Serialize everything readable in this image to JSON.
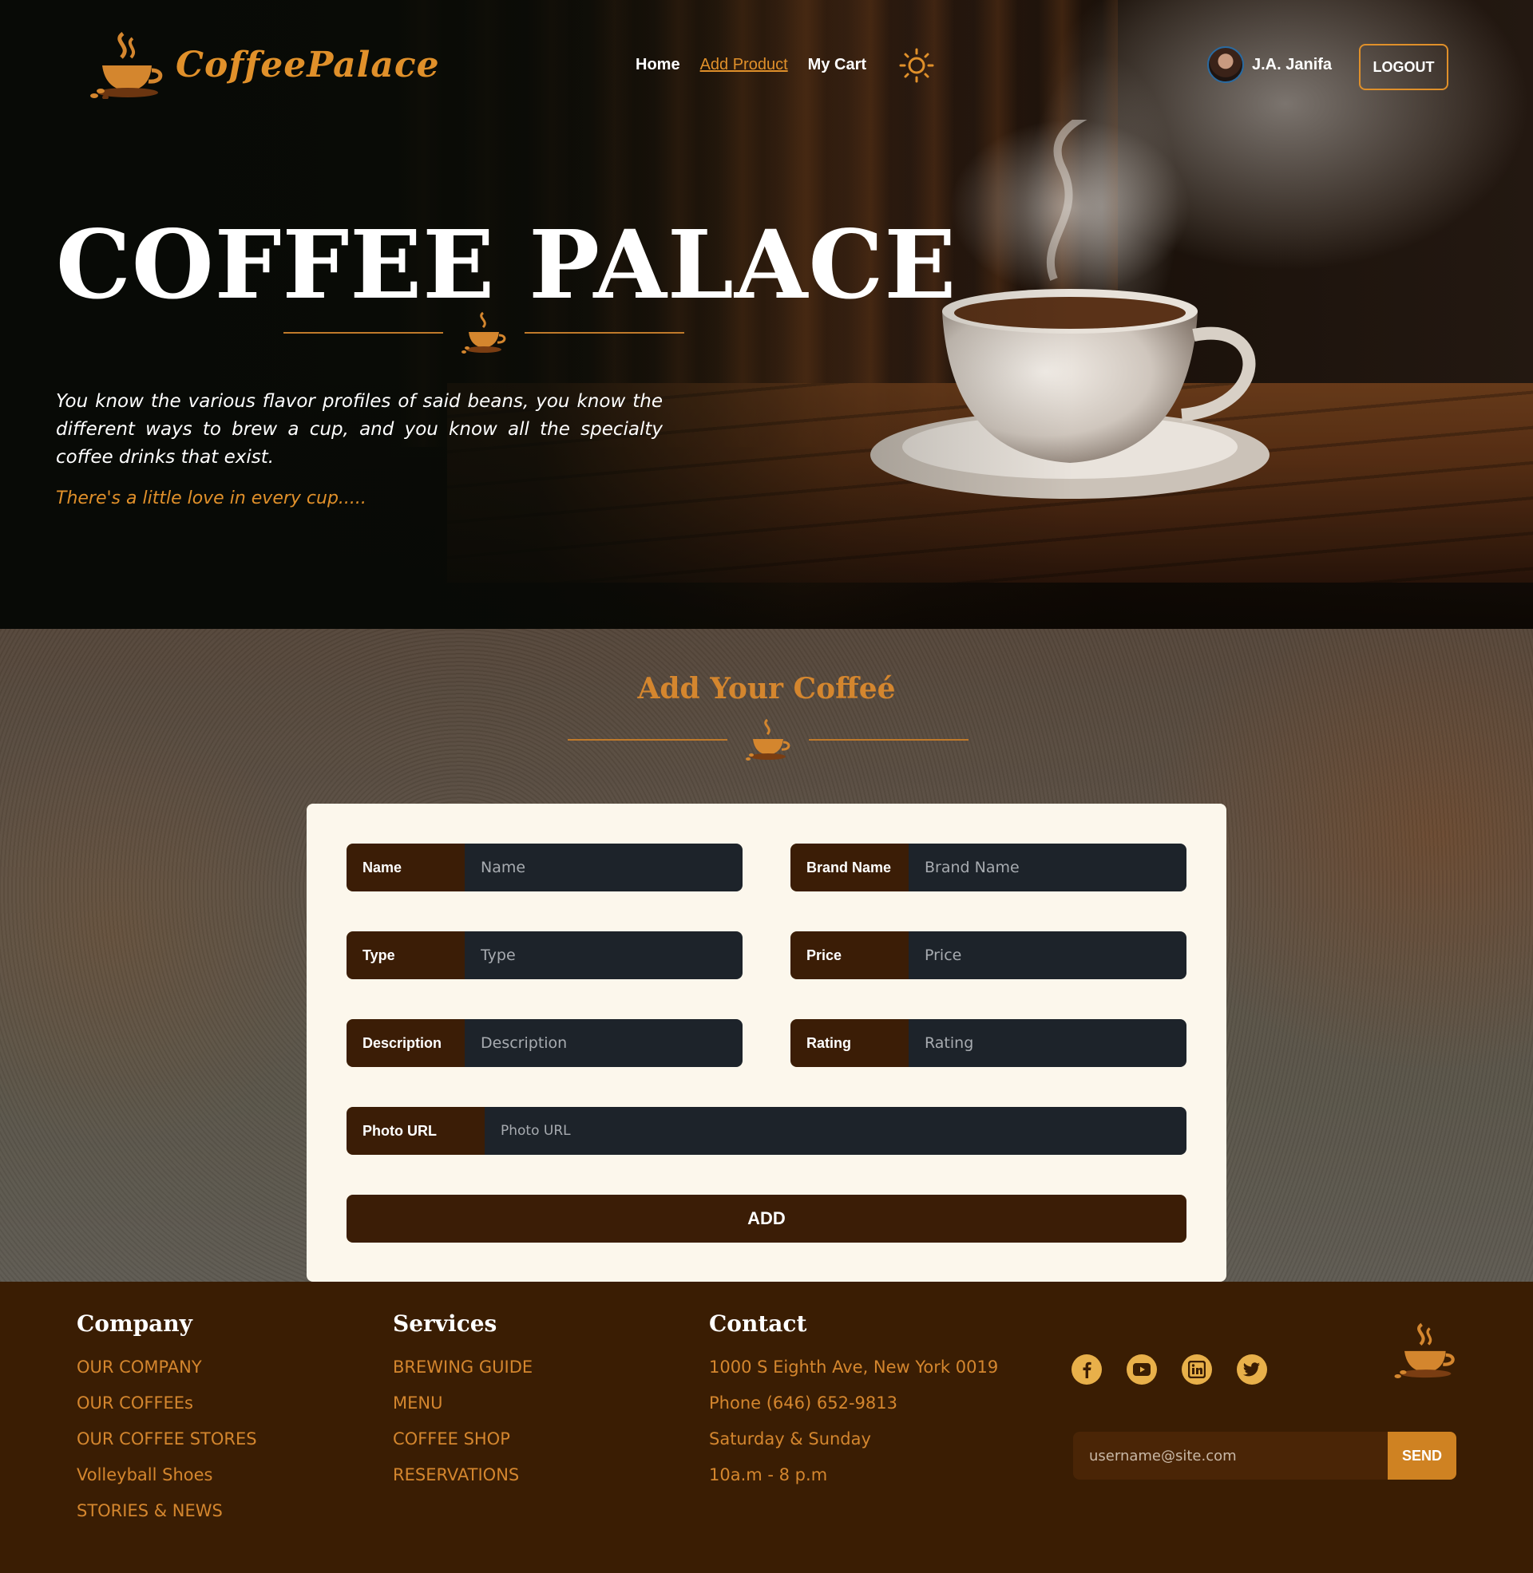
{
  "header": {
    "brand": "CoffeePalace",
    "nav": [
      {
        "label": "Home",
        "active": false
      },
      {
        "label": "Add Product",
        "active": true
      },
      {
        "label": "My Cart",
        "active": false
      }
    ],
    "theme_icon": "sun-icon",
    "user_name": "J.A. Janifa",
    "logout_label": "LOGOUT"
  },
  "hero": {
    "title": "COFFEE PALACE",
    "text": "You know the various flavor profiles of said beans, you know the different ways to brew a cup, and you know all the specialty coffee drinks that exist.",
    "tagline": "There's a little love in every cup....."
  },
  "form": {
    "title": "Add Your Coffeé",
    "fields": [
      {
        "label": "Name",
        "placeholder": "Name",
        "value": ""
      },
      {
        "label": "Brand Name",
        "placeholder": "Brand Name",
        "value": ""
      },
      {
        "label": "Type",
        "placeholder": "Type",
        "value": ""
      },
      {
        "label": "Price",
        "placeholder": "Price",
        "value": ""
      },
      {
        "label": "Description",
        "placeholder": "Description",
        "value": ""
      },
      {
        "label": "Rating",
        "placeholder": "Rating",
        "value": ""
      },
      {
        "label": "Photo URL",
        "placeholder": "Photo URL",
        "value": ""
      }
    ],
    "submit_label": "ADD"
  },
  "footer": {
    "company": {
      "title": "Company",
      "items": [
        "OUR COMPANY",
        "OUR COFFEEs",
        "OUR COFFEE STORES",
        "Volleyball Shoes",
        "STORIES & NEWS"
      ]
    },
    "services": {
      "title": "Services",
      "items": [
        "BREWING GUIDE",
        "MENU",
        "COFFEE SHOP",
        "RESERVATIONS"
      ]
    },
    "contact": {
      "title": "Contact",
      "items": [
        "1000 S Eighth Ave, New York 0019",
        "Phone (646) 652-9813",
        "Saturday & Sunday",
        "10a.m - 8 p.m"
      ]
    },
    "socials": [
      "facebook-icon",
      "youtube-icon",
      "linkedin-icon",
      "twitter-icon"
    ],
    "subscribe": {
      "placeholder": "username@site.com",
      "value": "",
      "button_label": "SEND"
    }
  },
  "colors": {
    "accent": "#e0902a",
    "dark_brown": "#3b1d06",
    "input_bg": "#1d232a",
    "card_bg": "#fcf7ec",
    "footer_bg": "#3a1d03"
  }
}
